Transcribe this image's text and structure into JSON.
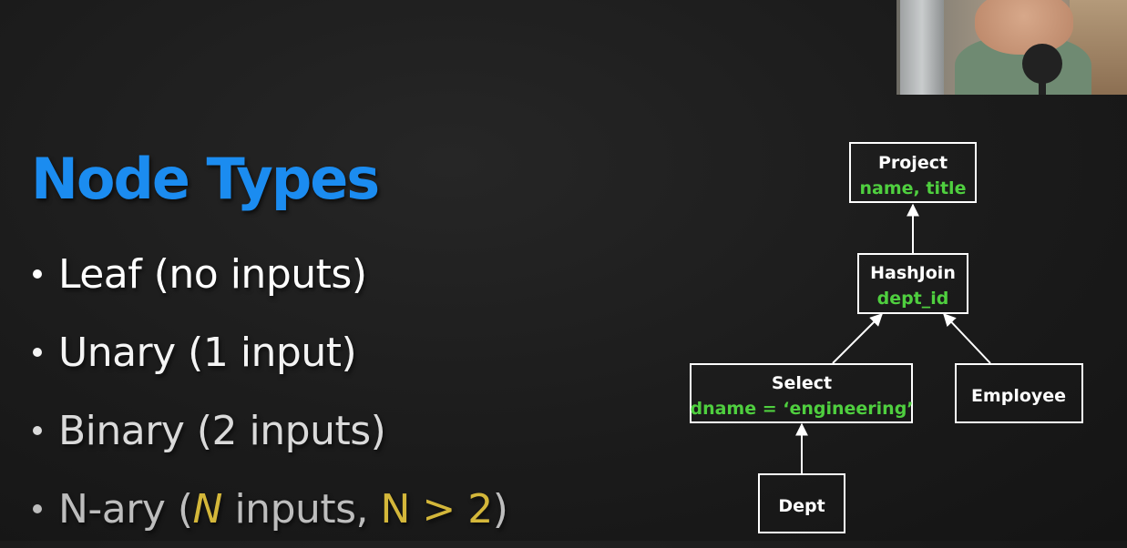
{
  "slide": {
    "title": "Node Types",
    "bullets": [
      {
        "text": "Leaf (no inputs)"
      },
      {
        "text": "Unary (1 input)"
      },
      {
        "text": "Binary (2 inputs)"
      },
      {
        "pre": "N-ary (",
        "n1": "N",
        "mid": " inputs, ",
        "cond": "N > 2",
        "post": ")"
      }
    ]
  },
  "diagram": {
    "nodes": {
      "project": {
        "label": "Project",
        "sub": "name, title"
      },
      "hashjoin": {
        "label": "HashJoin",
        "sub": "dept_id"
      },
      "select": {
        "label": "Select",
        "sub": "dname = ‘engineering’"
      },
      "employee": {
        "label": "Employee"
      },
      "dept": {
        "label": "Dept"
      }
    }
  },
  "colors": {
    "title": "#1b8cf0",
    "predicate": "#4fcf3f",
    "highlight": "#d4b73a"
  }
}
